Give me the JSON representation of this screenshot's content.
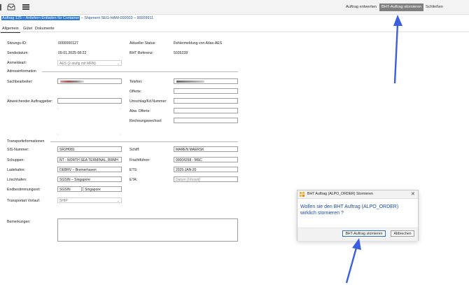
{
  "toolbar": {
    "draft_label": "Auftrag entwerten",
    "cancel_order_label": "BHT-Auftrag stornieren",
    "close_label": "Schließen"
  },
  "breadcrumb": {
    "order": "Auftrag 125 – Anliefern Entladen für Container",
    "sep1": " – ",
    "shipment": "Shipment SEG-HAM-000003",
    "sep2": " – ",
    "number": "90009911"
  },
  "tabs": [
    "Allgemein",
    "Güter",
    "Dokumente"
  ],
  "general": {
    "session_id_label": "Sitzungs-ID:",
    "session_id": "0000000127",
    "send_date_label": "Sendedatum:",
    "send_date": "09.01.2025 08:22",
    "registration_label": "Anmeldeart:",
    "registration": "AES (2-stufig mit MRN)",
    "status_label": "Aktueller Status:",
    "status": "Fehlermeldung von Atlas-AES",
    "bht_ref_label": "BHT Referenz:",
    "bht_ref": "5035228"
  },
  "address": {
    "section": "Adressinformation",
    "agent_label": "Sachbearbeiter:",
    "alt_client_label": "Abweichender Auftraggeber:",
    "phone_label": "Telefon:",
    "offer_label": "Offerte:",
    "transship_label": "Umschlag/Kd.Nummer:",
    "alt_offer_label": "Abw. Offerte:",
    "invoice_change_label": "Rechnungswechsel:"
  },
  "transport": {
    "section": "Transportinformationen",
    "sis_label": "SIS-Nummer:",
    "sis": "SR2H081",
    "shed_label": "Schuppen:",
    "shed": "NT - NORTH SEA TERMINAL, BRMH",
    "load_port_label": "Ladehafen:",
    "load_port": "DEBRV – Bremerhaven",
    "discharge_port_label": "Löschhafen:",
    "discharge_port": "SGSIN – Singapore",
    "destination_label": "Endbestimmungsort:",
    "destination_code": "SGSIN",
    "destination_name": "Singapore",
    "pre_carriage_label": "Transportart Vorlauf:",
    "pre_carriage": "SHIP",
    "ship_label": "Schiff:",
    "ship": "MAREN MAERSK",
    "carrier_label": "Frachtführer:",
    "carrier": "00004258 - MSC",
    "ets_label": "ETS:",
    "ets": "2025-JAN-20",
    "eta_label": "ETA:",
    "eta_placeholder": "Datum [Uhrzeit]"
  },
  "remarks_label": "Bemerkungen:",
  "dialog": {
    "title": "BHT Auftrag (ALPO_ORDER) Stornieren",
    "close_glyph": "✕",
    "message": "Wollen sie den BHT Auftrag (ALPO_ORDER) wirklich stornieren ?",
    "confirm_label": "BHT-Auftrag stornieren",
    "cancel_label": "Abbrechen"
  },
  "colors": {
    "accent": "#2a78d6",
    "arrow": "#3c5fe0",
    "dialog_text": "#1b4aa0"
  }
}
